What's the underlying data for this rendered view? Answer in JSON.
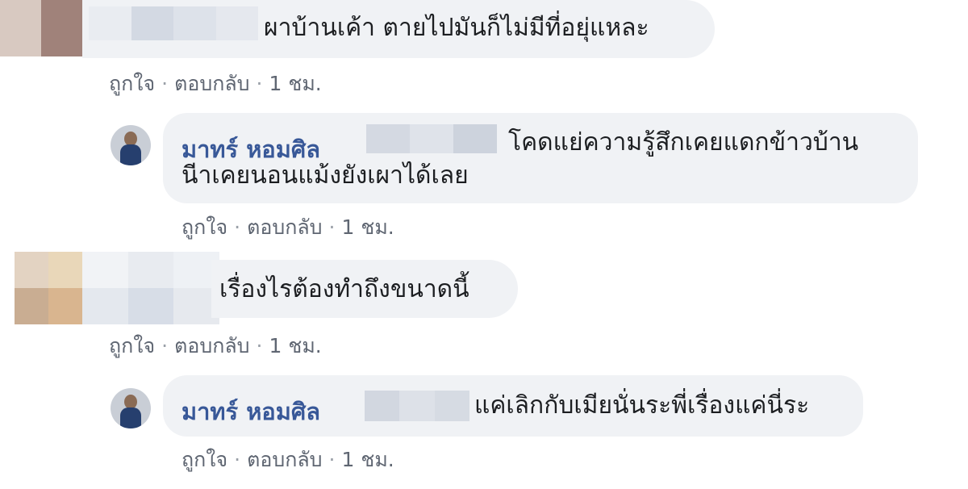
{
  "comments": [
    {
      "text": "ผาบ้านเค้า ตายไปมันก็ไม่มีที่อยุ่แหละ",
      "actions": {
        "like": "ถูกใจ",
        "reply": "ตอบกลับ",
        "time": "1 ชม."
      },
      "reply": {
        "author": "มาทร์ หอมศิล",
        "text_line1": "โคดแย่ความรู้สึกเคยแดกข้าวบ้าน",
        "text_line2": "นีาเคยนอนแม้งยังเผาได้เลย",
        "actions": {
          "like": "ถูกใจ",
          "reply": "ตอบกลับ",
          "time": "1 ชม."
        }
      }
    },
    {
      "text": "เรื่องไรต้องทำถึงขนาดนี้",
      "actions": {
        "like": "ถูกใจ",
        "reply": "ตอบกลับ",
        "time": "1 ชม."
      },
      "reply": {
        "author": "มาทร์ หอมศิล",
        "text": "แค่เลิกกับเมียนั่นระพี่เรื่องแค่นี่ระ",
        "actions": {
          "like": "ถูกใจ",
          "reply": "ตอบกลับ",
          "time": "1 ชม."
        }
      }
    }
  ],
  "colors": {
    "bubble": "#f0f2f5",
    "author": "#385898",
    "action_text": "#5f6672"
  }
}
